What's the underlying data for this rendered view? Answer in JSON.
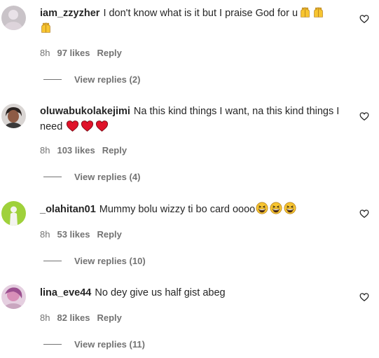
{
  "comments": [
    {
      "username": "iam_zzyzher",
      "text": "I don't know what is it but I praise God for u",
      "emoji": "raised-hands",
      "emoji_count": 3,
      "time": "8h",
      "likes": "97 likes",
      "reply_label": "Reply",
      "view_replies": "View replies (2)"
    },
    {
      "username": "oluwabukolakejimi",
      "text": "Na this kind things I want, na this kind things I need",
      "emoji": "red-heart",
      "emoji_count": 3,
      "time": "8h",
      "likes": "103 likes",
      "reply_label": "Reply",
      "view_replies": "View replies (4)"
    },
    {
      "username": "_olahitan01",
      "text": "Mummy bolu wizzy ti bo card oooo",
      "emoji": "grinning-squinting-face",
      "emoji_count": 3,
      "time": "8h",
      "likes": "53 likes",
      "reply_label": "Reply",
      "view_replies": "View replies (10)"
    },
    {
      "username": "lina_eve44",
      "text": "No dey give us half gist abeg",
      "emoji": "",
      "emoji_count": 0,
      "time": "8h",
      "likes": "82 likes",
      "reply_label": "Reply",
      "view_replies": "View replies (11)"
    }
  ],
  "colors": {
    "text": "#262626",
    "secondary": "#737373",
    "heart_emoji": "#e0132a",
    "face_emoji": "#f7c531"
  }
}
